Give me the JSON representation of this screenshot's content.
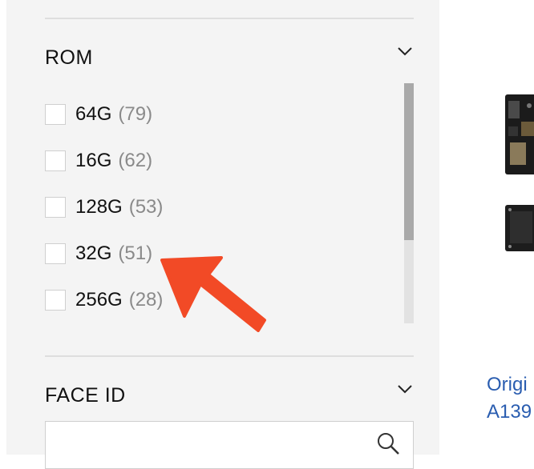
{
  "filters": {
    "rom": {
      "title": "ROM",
      "options": [
        {
          "label": "64G",
          "count": "(79)"
        },
        {
          "label": "16G",
          "count": "(62)"
        },
        {
          "label": "128G",
          "count": "(53)"
        },
        {
          "label": "32G",
          "count": "(51)"
        },
        {
          "label": "256G",
          "count": "(28)"
        }
      ]
    },
    "face_id": {
      "title": "FACE ID",
      "search_value": ""
    }
  },
  "product": {
    "title_line1": "Origi",
    "title_line2": "A139"
  },
  "colors": {
    "sidebar_bg": "#f4f4f4",
    "link": "#2a5db0",
    "annotation_arrow": "#f24a26"
  }
}
